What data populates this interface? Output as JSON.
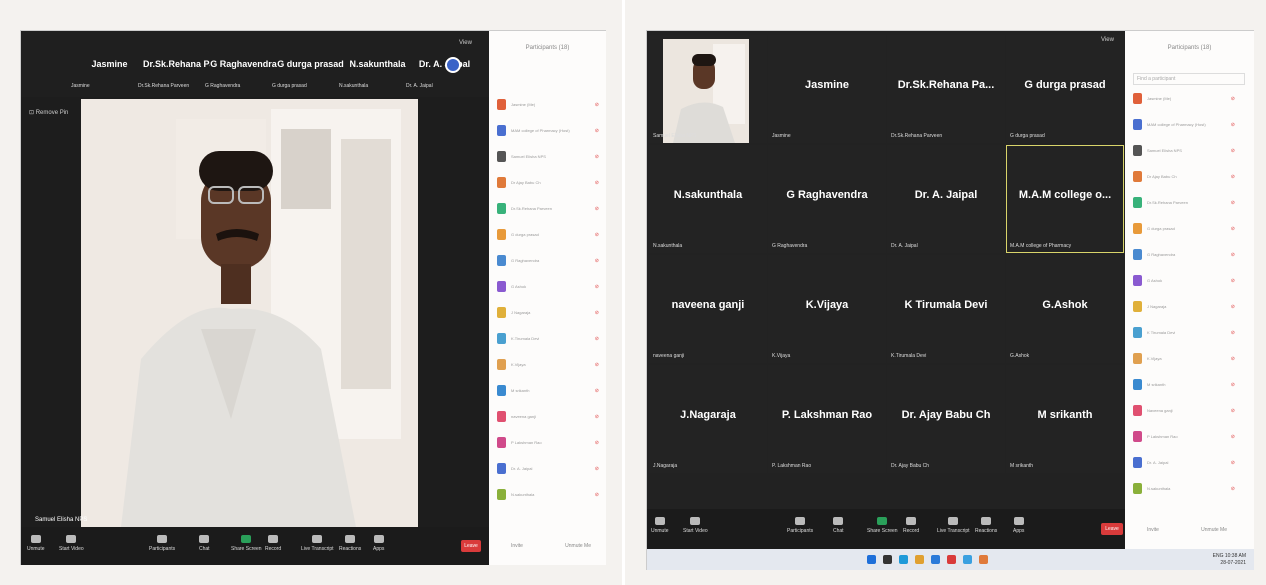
{
  "colors": {
    "participant_avatar": "#e07a3a",
    "avatar_alt": "#4a6fd0",
    "leave": "#d93b3b",
    "highlight": "#d9d46a",
    "green": "#2aa05a"
  },
  "left": {
    "view_label": "View",
    "top_names": [
      "Jasmine",
      "Dr.Sk.Rehana Pa...",
      "G Raghavendra",
      "G durga prasad",
      "N.sakunthala",
      "Dr. A. Jaipal"
    ],
    "sub_names": [
      "Jasmine",
      "Dr.Sk.Rehana Parveen",
      "G Raghavendra",
      "G durga prasad",
      "N.sakunthala",
      "Dr. A. Jaipal"
    ],
    "remove_label": "Remove Pin",
    "speaker_tag": "Samuel Elisha NPS",
    "toolbar": [
      "Unmute",
      "Start Video",
      "Participants",
      "Chat",
      "Share Screen",
      "Record",
      "Live Transcript",
      "Reactions",
      "Apps"
    ],
    "leave": "Leave",
    "panel_title": "Participants (18)",
    "participants": [
      "Jasmine (Me)",
      "MAM college of Pharmacy (Host)",
      "Samuel Elisha NPS",
      "Dr Ajay Babu Ch",
      "Dr.Sk.Rehana Parveen",
      "G durga prasad",
      "G Raghavendra",
      "G Ashok",
      "J Nagaraja",
      "K.Tirumala Devi",
      "K.Vijaya",
      "M srikanth",
      "naveena ganji",
      "P Lakshman Rao",
      "Dr. A. Jaipal",
      "N.sakunthala"
    ],
    "panel_buttons": [
      "Invite",
      "Unmute Me"
    ]
  },
  "right": {
    "view_label": "View",
    "self_tag": "Samuel Elisha NPS",
    "tiles": [
      {
        "name": "",
        "sub": "Samuel Elisha NPS"
      },
      {
        "name": "Jasmine",
        "sub": "Jasmine"
      },
      {
        "name": "Dr.Sk.Rehana Pa...",
        "sub": "Dr.Sk.Rehana Parveen"
      },
      {
        "name": "G durga prasad",
        "sub": "G durga prasad"
      },
      {
        "name": "N.sakunthala",
        "sub": "N.sakunthala"
      },
      {
        "name": "G Raghavendra",
        "sub": "G Raghavendra"
      },
      {
        "name": "Dr. A. Jaipal",
        "sub": "Dr. A. Jaipal"
      },
      {
        "name": "M.A.M college o...",
        "sub": "M.A.M college of Pharmacy"
      },
      {
        "name": "naveena ganji",
        "sub": "naveena ganji"
      },
      {
        "name": "K.Vijaya",
        "sub": "K.Vijaya"
      },
      {
        "name": "K Tirumala Devi",
        "sub": "K.Tirumala Devi"
      },
      {
        "name": "G.Ashok",
        "sub": "G.Ashok"
      },
      {
        "name": "J.Nagaraja",
        "sub": "J.Nagaraja"
      },
      {
        "name": "P. Lakshman Rao",
        "sub": "P. Lakshman Rao"
      },
      {
        "name": "Dr. Ajay Babu Ch",
        "sub": "Dr. Ajay Babu Ch"
      },
      {
        "name": "M srikanth",
        "sub": "M srikanth"
      }
    ],
    "toolbar": [
      "Unmute",
      "Start Video",
      "Participants",
      "Chat",
      "Share Screen",
      "Record",
      "Live Transcript",
      "Reactions",
      "Apps"
    ],
    "leave": "Leave",
    "panel_title": "Participants (18)",
    "search_placeholder": "Find a participant",
    "participants": [
      "Jasmine (Me)",
      "MAM college of Pharmacy (Host)",
      "Samuel Elisha NPS",
      "Dr Ajay Babu Ch",
      "Dr.Sk.Rehana Parveen",
      "G durga prasad",
      "G Raghavendra",
      "G Ashok",
      "J Nagaraja",
      "K Tirumala Devi",
      "K.Vijaya",
      "M srikanth",
      "Naveena ganji",
      "P Lakshman Rao",
      "Dr. A. Jaipal",
      "N.sakunthala"
    ],
    "panel_buttons": [
      "Invite",
      "Unmute Me"
    ],
    "clock": {
      "time": "10:38 AM",
      "date": "28-07-2021",
      "lang": "ENG"
    }
  }
}
